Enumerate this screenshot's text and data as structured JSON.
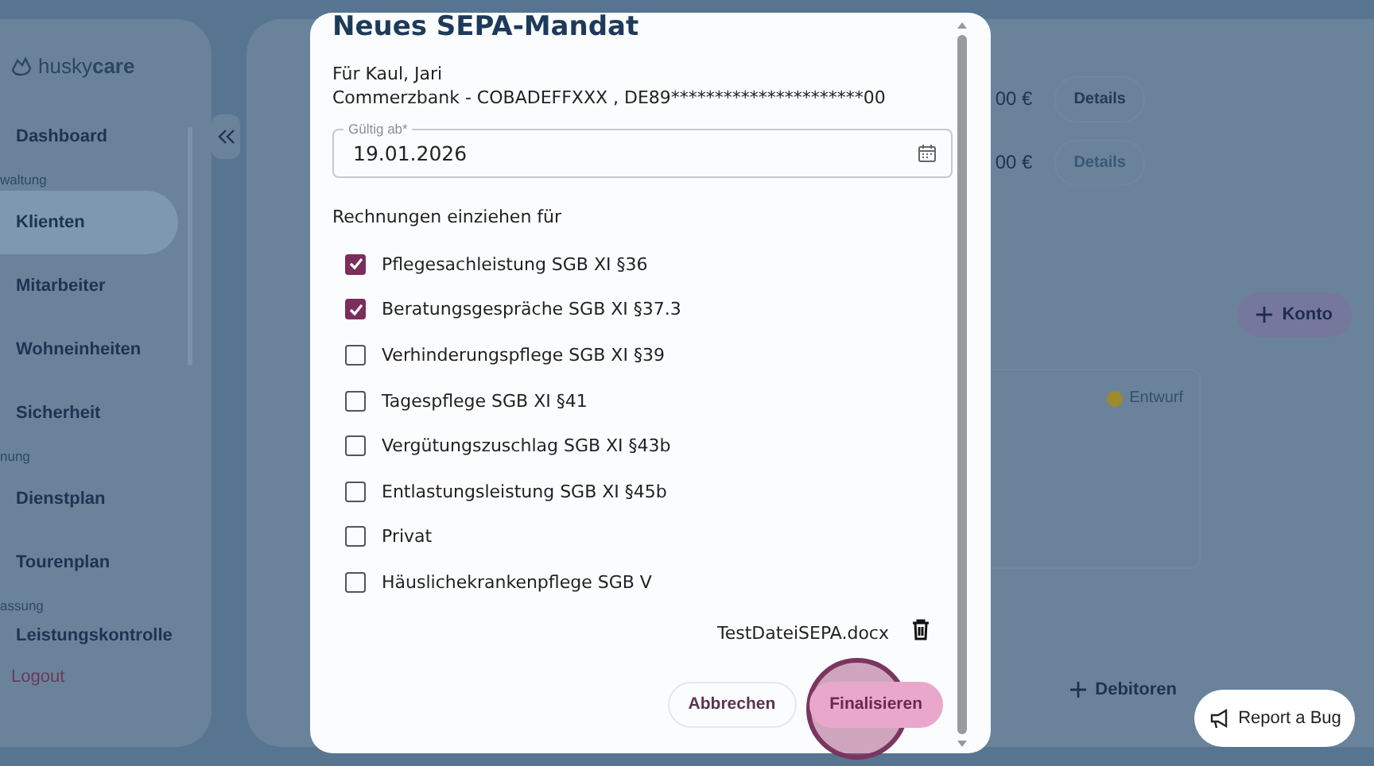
{
  "sidebar": {
    "logo_light": "husky",
    "logo_bold": "care",
    "items": [
      {
        "kind": "link",
        "label": "Dashboard",
        "selected": false
      },
      {
        "kind": "section",
        "label": "waltung"
      },
      {
        "kind": "link",
        "label": "Klienten",
        "selected": true
      },
      {
        "kind": "link",
        "label": "Mitarbeiter",
        "selected": false
      },
      {
        "kind": "link",
        "label": "Wohneinheiten",
        "selected": false
      },
      {
        "kind": "link",
        "label": "Sicherheit",
        "selected": false
      },
      {
        "kind": "section",
        "label": "nung"
      },
      {
        "kind": "link",
        "label": "Dienstplan",
        "selected": false
      },
      {
        "kind": "link",
        "label": "Tourenplan",
        "selected": false
      },
      {
        "kind": "section",
        "label": "assung"
      },
      {
        "kind": "link",
        "label": "Leistungskontrolle",
        "selected": false
      }
    ],
    "logout": "Logout"
  },
  "main": {
    "amounts": [
      {
        "value": "00 €",
        "button": "Details",
        "disabled": false
      },
      {
        "value": "00 €",
        "button": "Details",
        "disabled": true
      }
    ],
    "account_button": "Konto",
    "card_status": {
      "label": "Entwurf",
      "color": "#9c8a2c"
    },
    "debtor_button": "Debitoren"
  },
  "dialog": {
    "title": "Neues SEPA-Mandat",
    "recipient": "Für Kaul, Jari",
    "account": "Commerzbank - COBADEFFXXX , DE89**********************00",
    "date_field": {
      "label": "Gültig ab*",
      "value": "19.01.2026"
    },
    "section_label": "Rechnungen einziehen für",
    "options": [
      {
        "label": "Pflegesachleistung SGB XI §36",
        "checked": true
      },
      {
        "label": "Beratungsgespräche SGB XI §37.3",
        "checked": true
      },
      {
        "label": "Verhinderungspflege SGB XI §39",
        "checked": false
      },
      {
        "label": "Tagespflege SGB XI §41",
        "checked": false
      },
      {
        "label": "Vergütungszuschlag SGB XI §43b",
        "checked": false
      },
      {
        "label": "Entlastungsleistung SGB XI §45b",
        "checked": false
      },
      {
        "label": "Privat",
        "checked": false
      },
      {
        "label": "Häuslichekrankenpflege SGB V",
        "checked": false
      }
    ],
    "file": "TestDateiSEPA.docx",
    "buttons": [
      {
        "label": "Abbrechen",
        "kind": "secondary"
      },
      {
        "label": "Finalisieren",
        "kind": "primary"
      }
    ]
  },
  "report_button": "Report a Bug"
}
